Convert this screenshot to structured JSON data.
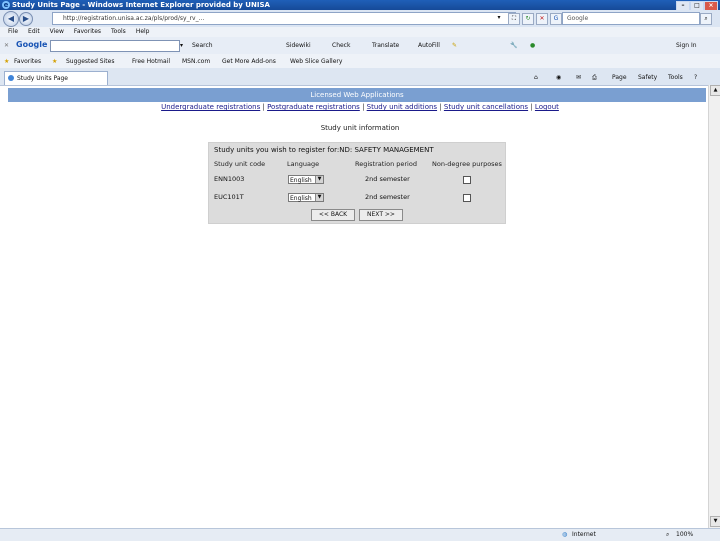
{
  "window": {
    "title": "Study Units Page - Windows Internet Explorer provided by UNISA",
    "min_label": "–",
    "max_label": "□",
    "close_label": "×"
  },
  "address": {
    "url": "http://registration.unisa.ac.za/pls/prod/sy_rv_...",
    "search_placeholder": "Google"
  },
  "menu": [
    "File",
    "Edit",
    "View",
    "Favorites",
    "Tools",
    "Help"
  ],
  "google_toolbar": {
    "logo": "Google",
    "items": [
      "Search",
      "Sidewiki",
      "Check",
      "Translate",
      "AutoFill",
      "Sign In"
    ]
  },
  "favorites": {
    "label": "Favorites",
    "items": [
      "Suggested Sites",
      "Free Hotmail",
      "MSN.com",
      "Get More Add-ons",
      "Web Slice Gallery"
    ]
  },
  "tab": {
    "label": "Study Units Page"
  },
  "command_bar": [
    "Page",
    "Safety",
    "Tools"
  ],
  "content": {
    "banner": "Licensed Web Applications",
    "links": [
      {
        "label": "Undergraduate registrations"
      },
      {
        "label": "Postgraduate registrations"
      },
      {
        "label": "Study unit additions"
      },
      {
        "label": "Study unit cancellations"
      },
      {
        "label": "Logout"
      }
    ],
    "link_separator": "|",
    "info_title": "Study unit information",
    "panel_title": "Study units you wish to register for:ND: SAFETY MANAGEMENT",
    "columns": [
      "Study unit code",
      "Language",
      "Registration period",
      "Non-degree purposes"
    ],
    "rows": [
      {
        "code": "ENN1003",
        "language": "English",
        "period": "2nd semester",
        "non_degree": false
      },
      {
        "code": "EUC101T",
        "language": "English",
        "period": "2nd semester",
        "non_degree": false
      }
    ],
    "back_button": "<< BACK",
    "next_button": "NEXT >>"
  },
  "status": {
    "zone": "Internet",
    "zoom": "100%"
  }
}
